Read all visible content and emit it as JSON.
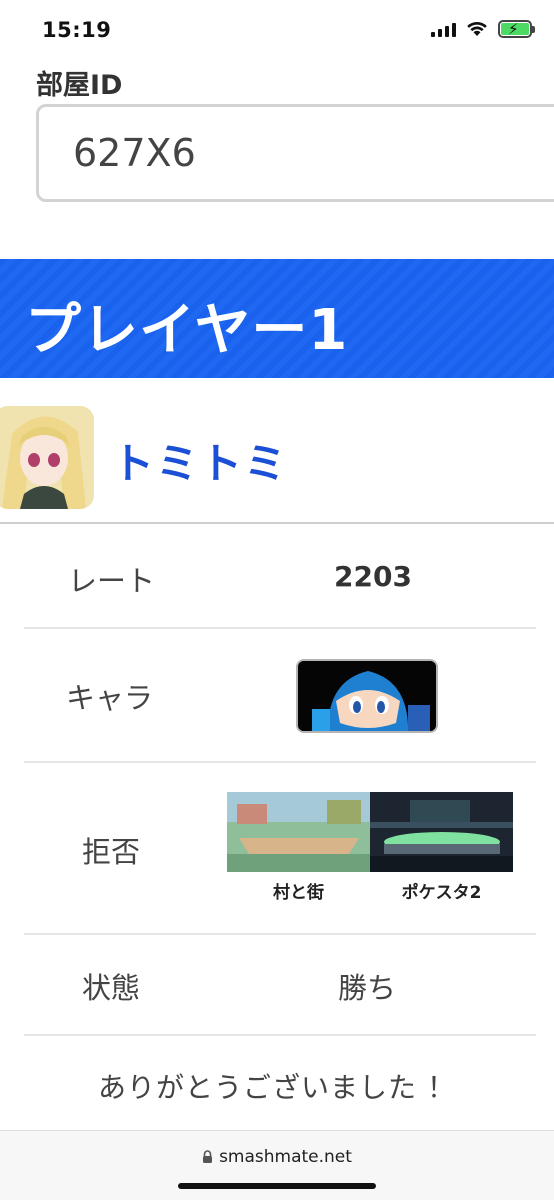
{
  "status_bar": {
    "time": "15:19"
  },
  "room": {
    "label": "部屋ID",
    "value": "627X6"
  },
  "player": {
    "title": "プレイヤー1",
    "name": "トミトミ"
  },
  "rows": {
    "rate": {
      "label": "レート",
      "value": "2203"
    },
    "chara": {
      "label": "キャラ"
    },
    "reject": {
      "label": "拒否",
      "stages": [
        {
          "name": "村と街"
        },
        {
          "name": "ポケスタ2"
        }
      ]
    },
    "state": {
      "label": "状態",
      "value": "勝ち"
    }
  },
  "message": "ありがとうございました ！",
  "browser": {
    "url": "smashmate.net"
  },
  "colors": {
    "accent": "#1a62ee",
    "name_link": "#1b4fd6"
  }
}
